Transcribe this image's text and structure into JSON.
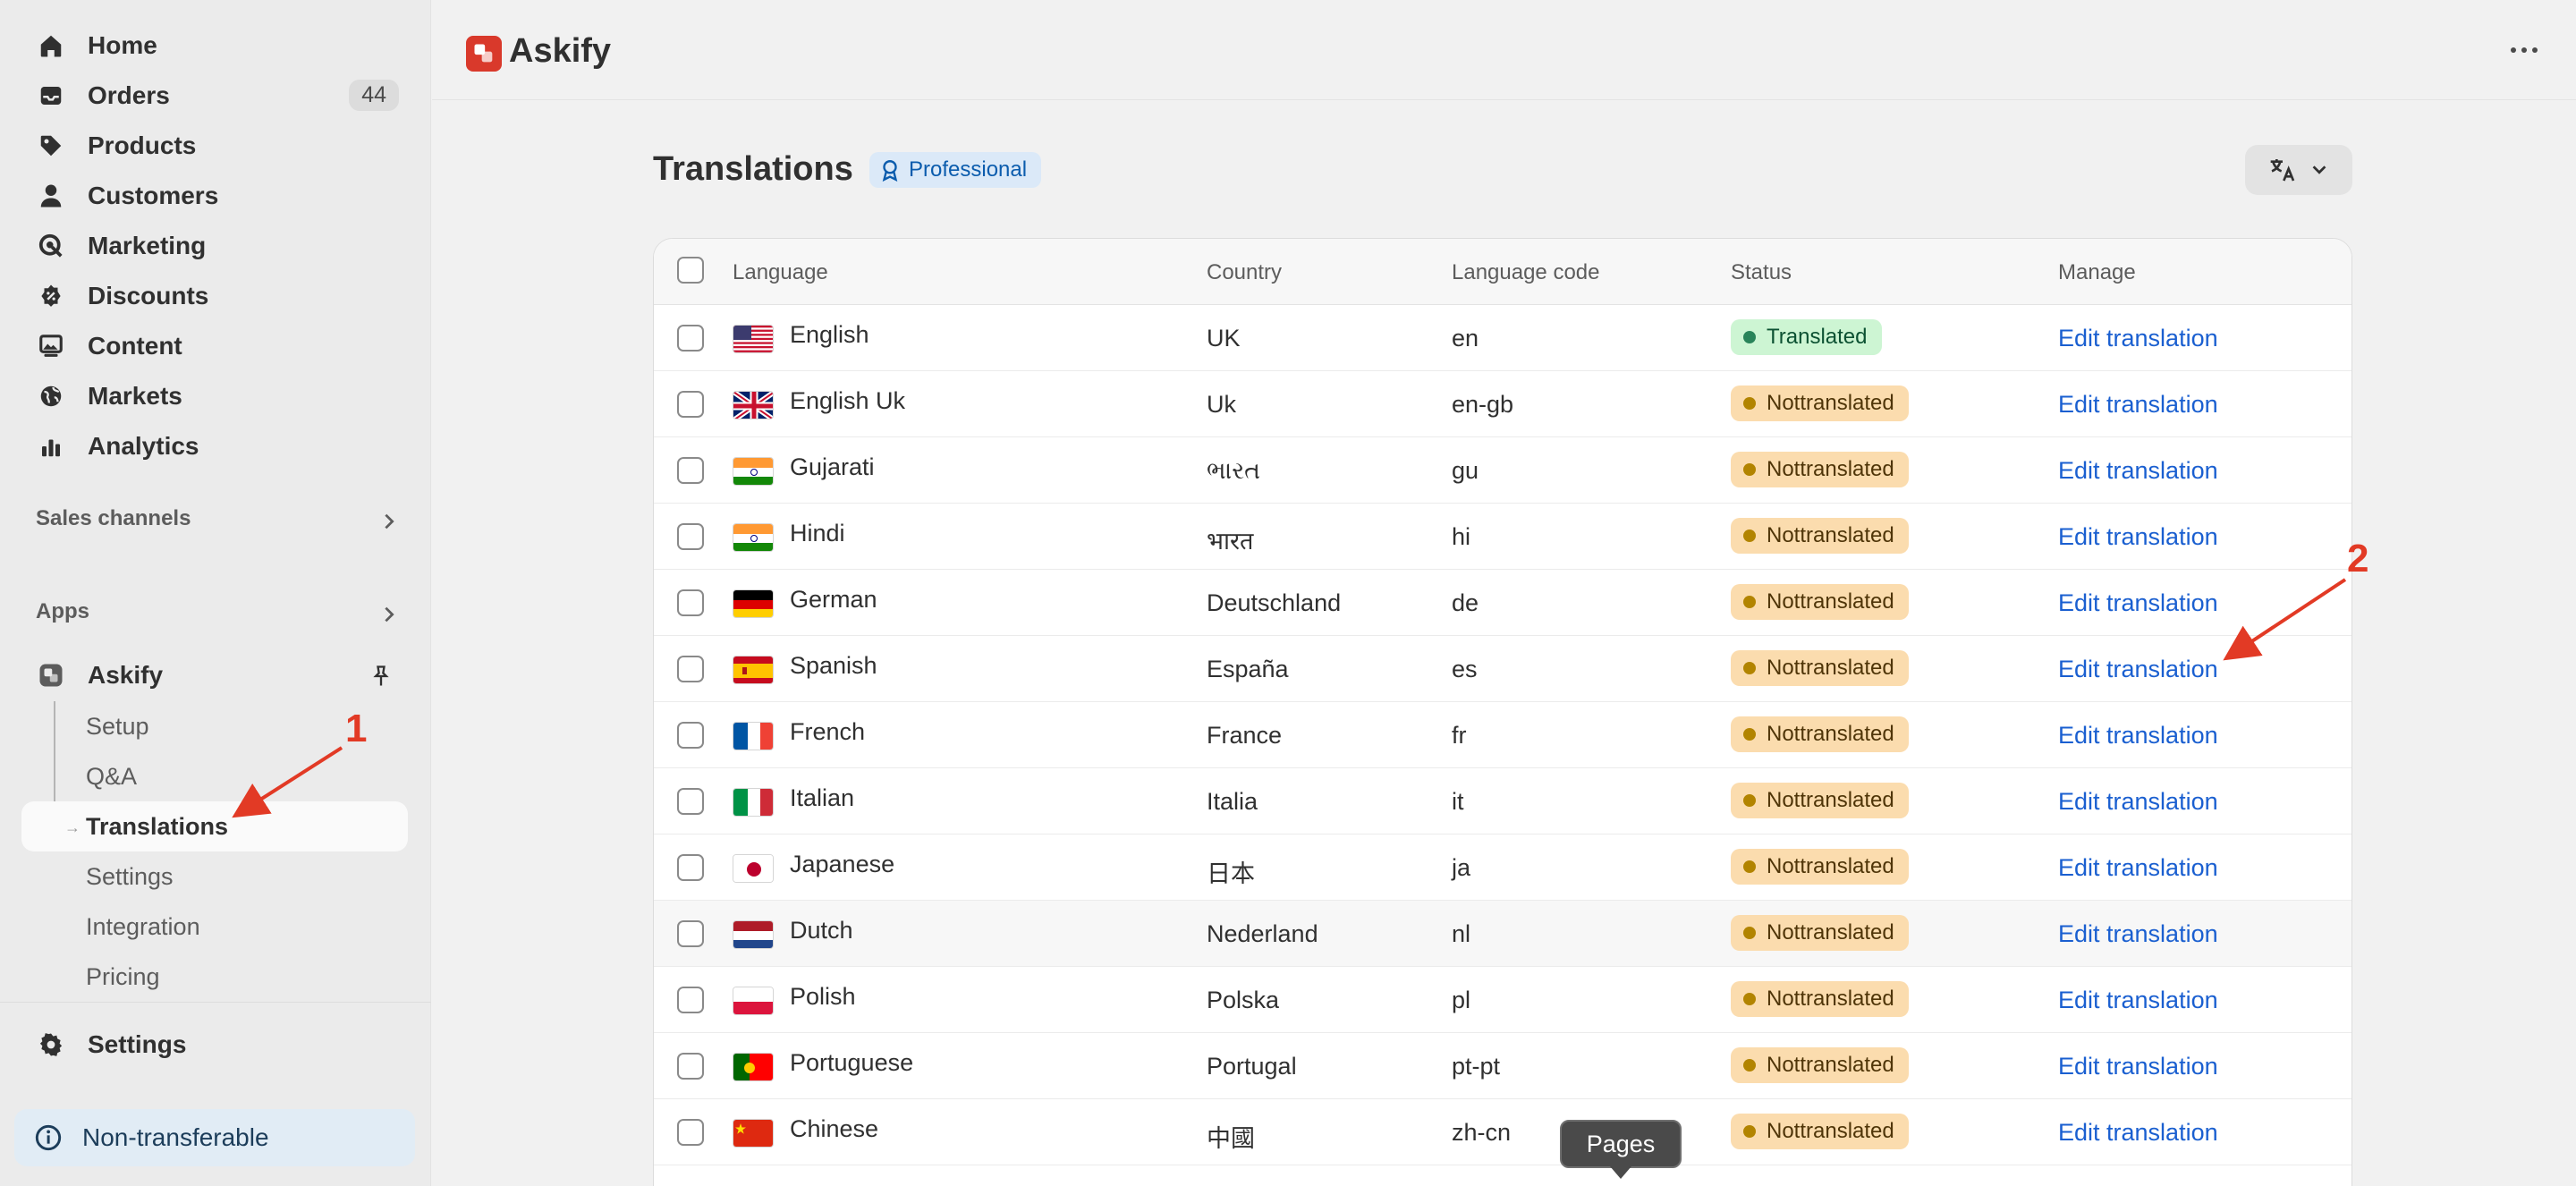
{
  "sidebar": {
    "nav": [
      {
        "label": "Home",
        "icon": "home-icon"
      },
      {
        "label": "Orders",
        "icon": "inbox-icon",
        "badge": "44"
      },
      {
        "label": "Products",
        "icon": "tag-icon"
      },
      {
        "label": "Customers",
        "icon": "person-icon"
      },
      {
        "label": "Marketing",
        "icon": "target-icon"
      },
      {
        "label": "Discounts",
        "icon": "discount-icon"
      },
      {
        "label": "Content",
        "icon": "image-icon"
      },
      {
        "label": "Markets",
        "icon": "globe-icon"
      },
      {
        "label": "Analytics",
        "icon": "bar-chart-icon"
      }
    ],
    "sales_channels": "Sales channels",
    "apps": "Apps",
    "app_name": "Askify",
    "sub_items": [
      "Setup",
      "Q&A",
      "Translations",
      "Settings",
      "Integration",
      "Pricing"
    ],
    "settings": "Settings",
    "non_transferable": "Non-transferable"
  },
  "topbar": {
    "title": "Askify"
  },
  "page": {
    "title": "Translations",
    "plan_badge": "Professional"
  },
  "table": {
    "columns": [
      "Language",
      "Country",
      "Language code",
      "Status",
      "Manage"
    ],
    "rows": [
      {
        "language": "English",
        "country": "UK",
        "code": "en",
        "status": "Translated",
        "flag": "us",
        "manage": "Edit translation"
      },
      {
        "language": "English Uk",
        "country": "Uk",
        "code": "en-gb",
        "status": "Nottranslated",
        "flag": "gb",
        "manage": "Edit translation"
      },
      {
        "language": "Gujarati",
        "country": "ભારત",
        "code": "gu",
        "status": "Nottranslated",
        "flag": "in",
        "manage": "Edit translation"
      },
      {
        "language": "Hindi",
        "country": "भारत",
        "code": "hi",
        "status": "Nottranslated",
        "flag": "in",
        "manage": "Edit translation"
      },
      {
        "language": "German",
        "country": "Deutschland",
        "code": "de",
        "status": "Nottranslated",
        "flag": "de",
        "manage": "Edit translation"
      },
      {
        "language": "Spanish",
        "country": "España",
        "code": "es",
        "status": "Nottranslated",
        "flag": "es",
        "manage": "Edit translation"
      },
      {
        "language": "French",
        "country": "France",
        "code": "fr",
        "status": "Nottranslated",
        "flag": "fr",
        "manage": "Edit translation"
      },
      {
        "language": "Italian",
        "country": "Italia",
        "code": "it",
        "status": "Nottranslated",
        "flag": "it",
        "manage": "Edit translation"
      },
      {
        "language": "Japanese",
        "country": "日本",
        "code": "ja",
        "status": "Nottranslated",
        "flag": "jp",
        "manage": "Edit translation"
      },
      {
        "language": "Dutch",
        "country": "Nederland",
        "code": "nl",
        "status": "Nottranslated",
        "flag": "nl",
        "manage": "Edit translation"
      },
      {
        "language": "Polish",
        "country": "Polska",
        "code": "pl",
        "status": "Nottranslated",
        "flag": "pl",
        "manage": "Edit translation"
      },
      {
        "language": "Portuguese",
        "country": "Portugal",
        "code": "pt-pt",
        "status": "Nottranslated",
        "flag": "pt",
        "manage": "Edit translation"
      },
      {
        "language": "Chinese",
        "country": "中國",
        "code": "zh-cn",
        "status": "Nottranslated",
        "flag": "cn",
        "manage": "Edit translation"
      }
    ]
  },
  "tooltip": "Pages",
  "annotations": {
    "marker_1": "1",
    "marker_2": "2"
  },
  "colors": {
    "accent_link": "#1a5fd0",
    "translated_bg": "#cdf5d3",
    "nottranslated_bg": "#fbdcae",
    "annotation": "#e23a25",
    "app_logo": "#d9392b"
  }
}
